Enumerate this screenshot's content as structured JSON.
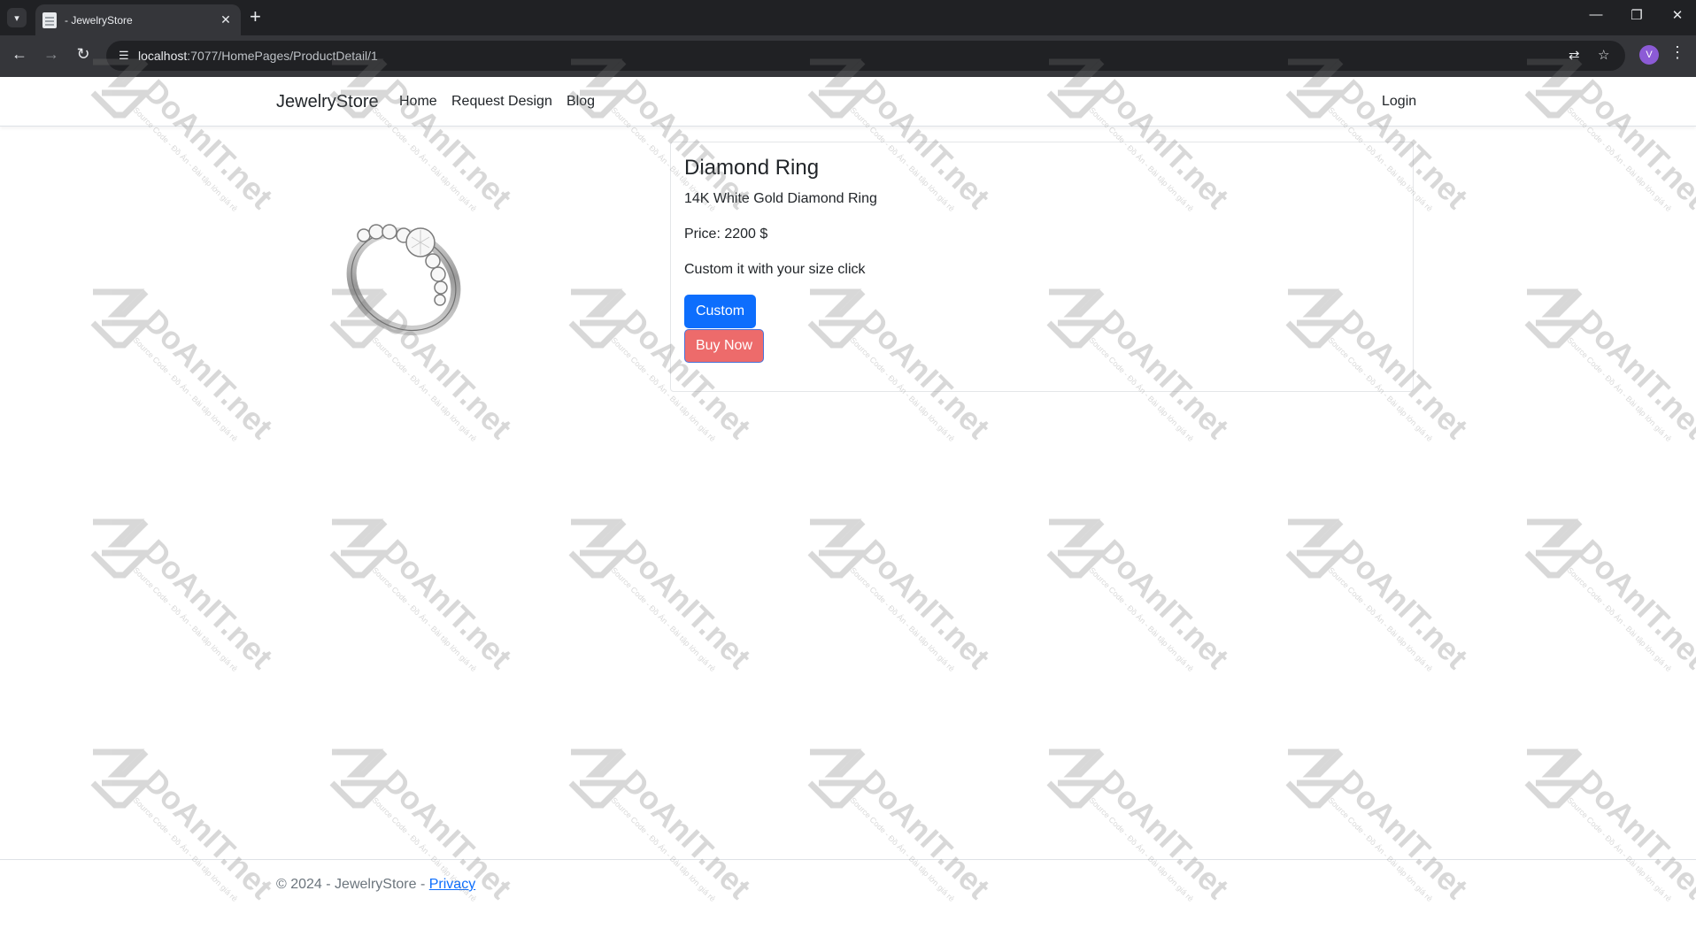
{
  "browser": {
    "tab_title": "- JewelryStore",
    "url_host": "localhost",
    "url_rest": ":7077/HomePages/ProductDetail/1",
    "profile_initial": "V"
  },
  "navbar": {
    "brand": "JewelryStore",
    "links": [
      "Home",
      "Request Design",
      "Blog"
    ],
    "login": "Login"
  },
  "product": {
    "name": "Diamond Ring",
    "description": "14K White Gold Diamond Ring",
    "price": "Price: 2200 $",
    "custom_note": "Custom it with your size click",
    "custom_button": "Custom",
    "buy_button": "Buy Now"
  },
  "footer": {
    "copyright": "© 2024 - JewelryStore - ",
    "privacy": "Privacy"
  },
  "watermark": {
    "main": "DoAnIT.net",
    "sub": "Source Code - Đồ Án - Bài tập lớn giá rẻ"
  }
}
